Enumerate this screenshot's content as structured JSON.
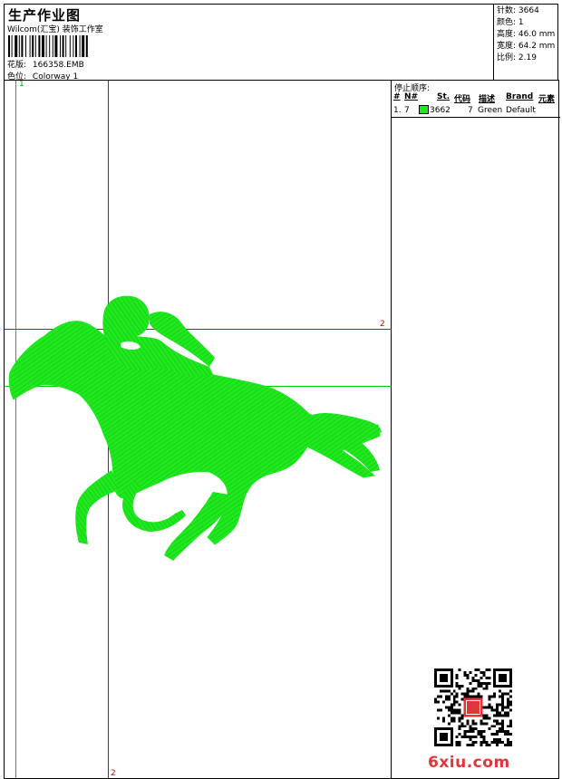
{
  "header": {
    "title": "生产作业图",
    "subtitle": "Wilcom(汇宝) 装饰工作室",
    "design_label": "花版:",
    "design_value": "166358.EMB",
    "color_label": "色位:",
    "color_value": "Colorway 1"
  },
  "stats": {
    "stitches": "针数: 3664",
    "colors": "颜色: 1",
    "height": "高度: 46.0 mm",
    "width": "宽度: 64.2 mm",
    "ratio": "比例: 2.19"
  },
  "stop_order": {
    "title": "停止顺序:",
    "columns": [
      "#",
      "N#",
      "St.",
      "代码",
      "描述",
      "Brand",
      "元素"
    ],
    "rows": [
      {
        "index": "1.",
        "needle": "7",
        "stitches": "3662",
        "code": "7",
        "description": "Green",
        "brand": "Default",
        "color": "#1fe81f"
      }
    ]
  },
  "canvas": {
    "marker_1": "1",
    "marker_2_right": "2",
    "marker_2_bottom": "2"
  },
  "watermark": {
    "site": "6xiu.com"
  },
  "colors": {
    "thread_green": "#1fe81f",
    "guide_red": "#dd0000",
    "guide_green": "#00cc00",
    "watermark_red": "#e2353a"
  }
}
